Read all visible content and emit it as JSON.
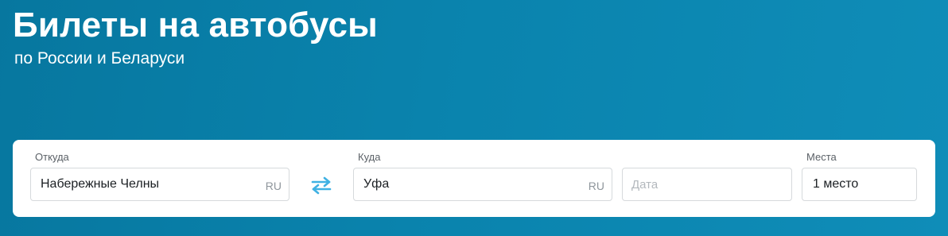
{
  "hero": {
    "title": "Билеты на автобусы",
    "subtitle": "по России и Беларуси"
  },
  "search_form": {
    "from": {
      "label": "Откуда",
      "value": "Набережные Челны",
      "country_code": "RU"
    },
    "swap": {
      "icon": "swap-arrows-icon"
    },
    "to": {
      "label": "Куда",
      "value": "Уфа",
      "country_code": "RU"
    },
    "date": {
      "placeholder": "Дата"
    },
    "seats": {
      "label": "Места",
      "value": "1 место"
    }
  },
  "colors": {
    "background_start": "#07779f",
    "background_end": "#0f8db8",
    "swap_icon": "#3fb1e3",
    "card": "#ffffff"
  }
}
